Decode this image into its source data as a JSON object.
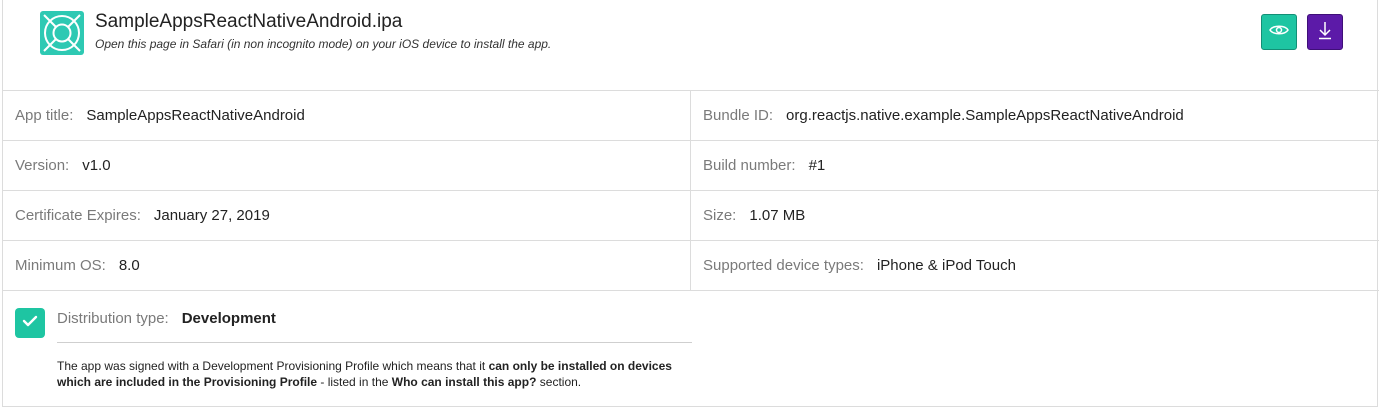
{
  "header": {
    "app_file_name": "SampleAppsReactNativeAndroid.ipa",
    "install_note": "Open this page in Safari (in non incognito mode) on your iOS device to install the app.",
    "app_icon": "target-icon",
    "preview_button_icon": "eye-icon",
    "download_button_icon": "download-icon"
  },
  "details": {
    "app_title_label": "App title:",
    "app_title_value": "SampleAppsReactNativeAndroid",
    "bundle_id_label": "Bundle ID:",
    "bundle_id_value": "org.reactjs.native.example.SampleAppsReactNativeAndroid",
    "version_label": "Version:",
    "version_value": "v1.0",
    "build_number_label": "Build number:",
    "build_number_value": "#1",
    "cert_expires_label": "Certificate Expires:",
    "cert_expires_value": "January 27, 2019",
    "size_label": "Size:",
    "size_value": "1.07 MB",
    "min_os_label": "Minimum OS:",
    "min_os_value": "8.0",
    "device_types_label": "Supported device types:",
    "device_types_value": "iPhone & iPod Touch"
  },
  "distribution": {
    "label": "Distribution type:",
    "value": "Development",
    "checked": true,
    "desc_part1": "The app was signed with a Development Provisioning Profile which means that it ",
    "desc_bold1": "can only be installed on devices which are included in the Provisioning Profile",
    "desc_part2": " - listed in the ",
    "desc_bold2": "Who can install this app?",
    "desc_part3": " section."
  },
  "colors": {
    "accent_teal": "#1ec5a2",
    "accent_purple": "#5c1aa8",
    "border": "#dcdcdc",
    "label_gray": "#7a7a7a"
  }
}
